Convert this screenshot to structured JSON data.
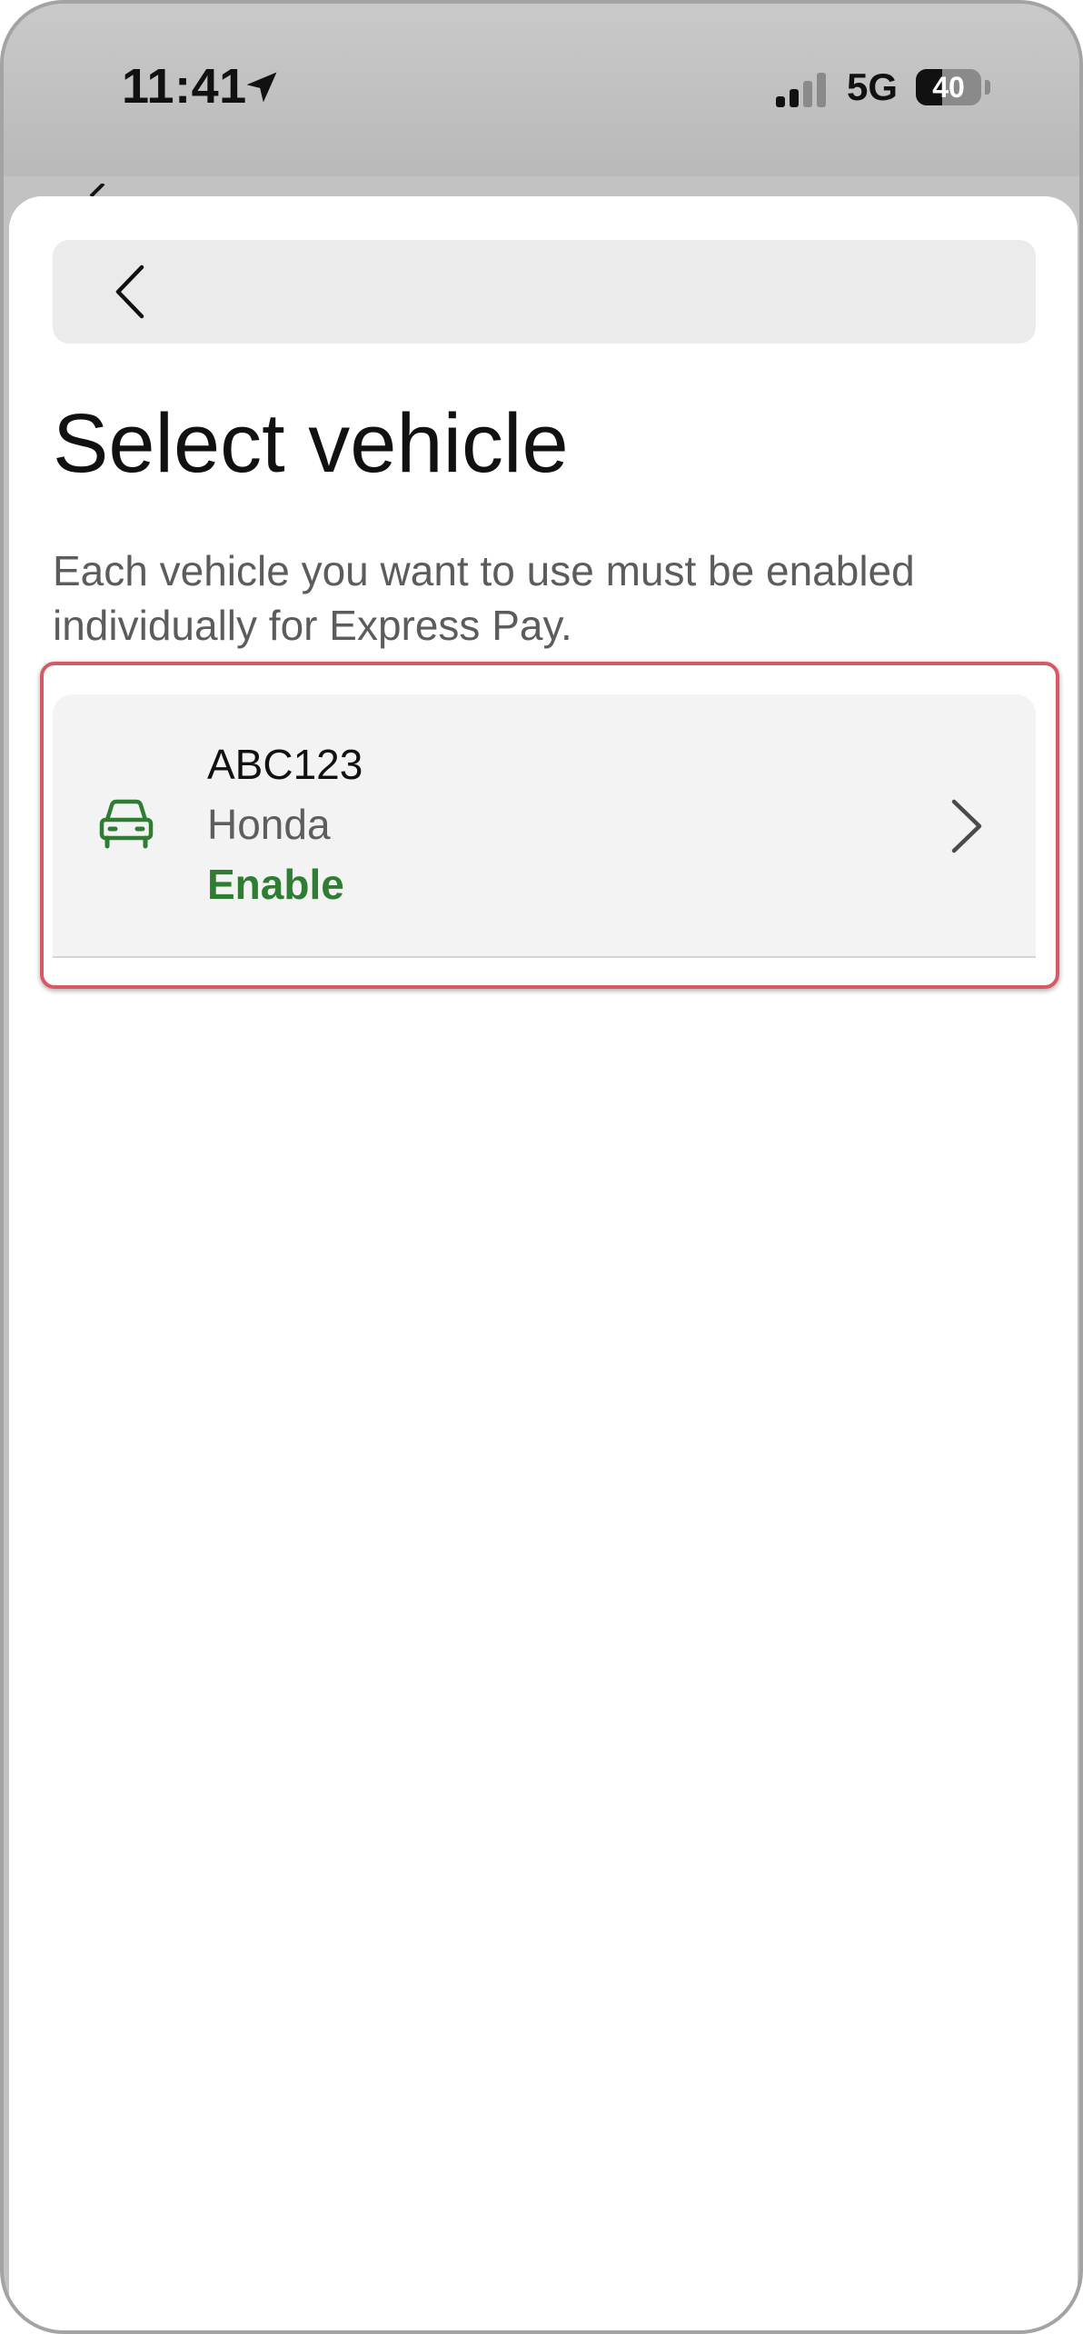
{
  "status_bar": {
    "time": "11:41",
    "location_icon": "location-arrow-icon",
    "network": "5G",
    "signal_icon": "cellular-signal-icon",
    "battery": "40",
    "battery_level": 0.4
  },
  "header": {
    "back_icon": "chevron-left-icon"
  },
  "page": {
    "title": "Select vehicle",
    "description": "Each vehicle you want to use must be enabled individually for Express Pay."
  },
  "vehicles": [
    {
      "plate": "ABC123",
      "make": "Honda",
      "action": "Enable",
      "icon": "car-icon",
      "chevron_icon": "chevron-right-icon"
    }
  ],
  "colors": {
    "accent_green": "#2e7d32",
    "highlight_red": "#d65a65"
  }
}
